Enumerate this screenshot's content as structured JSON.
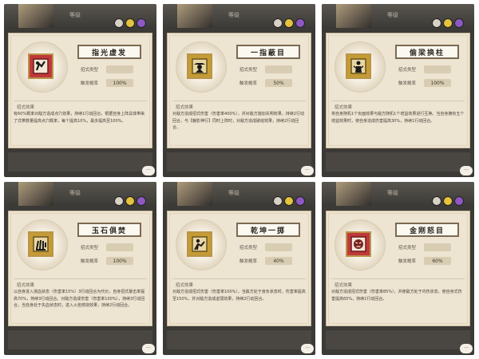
{
  "panels": [
    {
      "skill_name": "指光虚发",
      "level_label": "等级",
      "type_label": "招式类型",
      "trigger_label": "触发概率",
      "trigger_value": "100%",
      "effect_label": "招式效果",
      "description": "有60%概率对敌方造成点穴效果，持续1行动回合，根据自身上阵具体带来了式带数量提高点穴概率，每个提高10%，最多提高至100%。",
      "icon": "hand-strike-icon",
      "accent": "#c0383b"
    },
    {
      "skill_name": "一指蔽目",
      "level_label": "等级",
      "type_label": "招式类型",
      "trigger_label": "触发概率",
      "trigger_value": "50%",
      "effect_label": "招式效果",
      "description": "对敌方造成招式伤害（伤害率400%），并对敌方施加失明效果，持续2行动回合，与【魅影神行】同时上阵时，对敌方造成破绽效果，持续2行动回合。",
      "icon": "hat-figure-icon",
      "accent": "#c59b35"
    },
    {
      "skill_name": "偷梁换柱",
      "level_label": "等级",
      "type_label": "招式类型",
      "trigger_label": "触发概率",
      "trigger_value": "100%",
      "effect_label": "招式效果",
      "description": "将自身随机1个负面效果与敌方随机1个增益效果进行互换。当自身拥有五个增益效果时，使自身造成伤害提高30%，持续1行动回合。",
      "icon": "swap-figure-icon",
      "accent": "#c59b35"
    },
    {
      "skill_name": "玉石俱焚",
      "level_label": "等级",
      "type_label": "招式类型",
      "trigger_label": "触发概率",
      "trigger_value": "100%",
      "effect_label": "招式效果",
      "description": "以自身进入濒血状态（伤害率15%）3行动回合为代价，自身招式暴击率提高70%，持续3行动回合。对敌方造成伤害（伤害率100%），持续3行动回合，当自身处于失血状态时，进入火焰燃烧效果，持续2行动回合。",
      "icon": "claw-icon",
      "accent": "#c59b35"
    },
    {
      "skill_name": "乾坤一掷",
      "level_label": "等级",
      "type_label": "招式类型",
      "trigger_label": "触发概率",
      "trigger_value": "40%",
      "effect_label": "招式效果",
      "description": "对敌方造成招式伤害（伤害率100%），当敌方处于身负状态时，伤害率提高至150%，并对敌方造成虚弱效果，持续2行动回合。",
      "icon": "throw-figure-icon",
      "accent": "#c59b35"
    },
    {
      "skill_name": "金刚怒目",
      "level_label": "等级",
      "type_label": "招式类型",
      "trigger_label": "触发概率",
      "trigger_value": "60%",
      "effect_label": "招式效果",
      "description": "对敌方造成招式伤害（伤害率85%），并使敌方处于内伤状态，使自身式伤害提高65%，持续1行动回合。",
      "icon": "angry-face-icon",
      "accent": "#c0383b"
    }
  ],
  "chat_glyph": "···"
}
